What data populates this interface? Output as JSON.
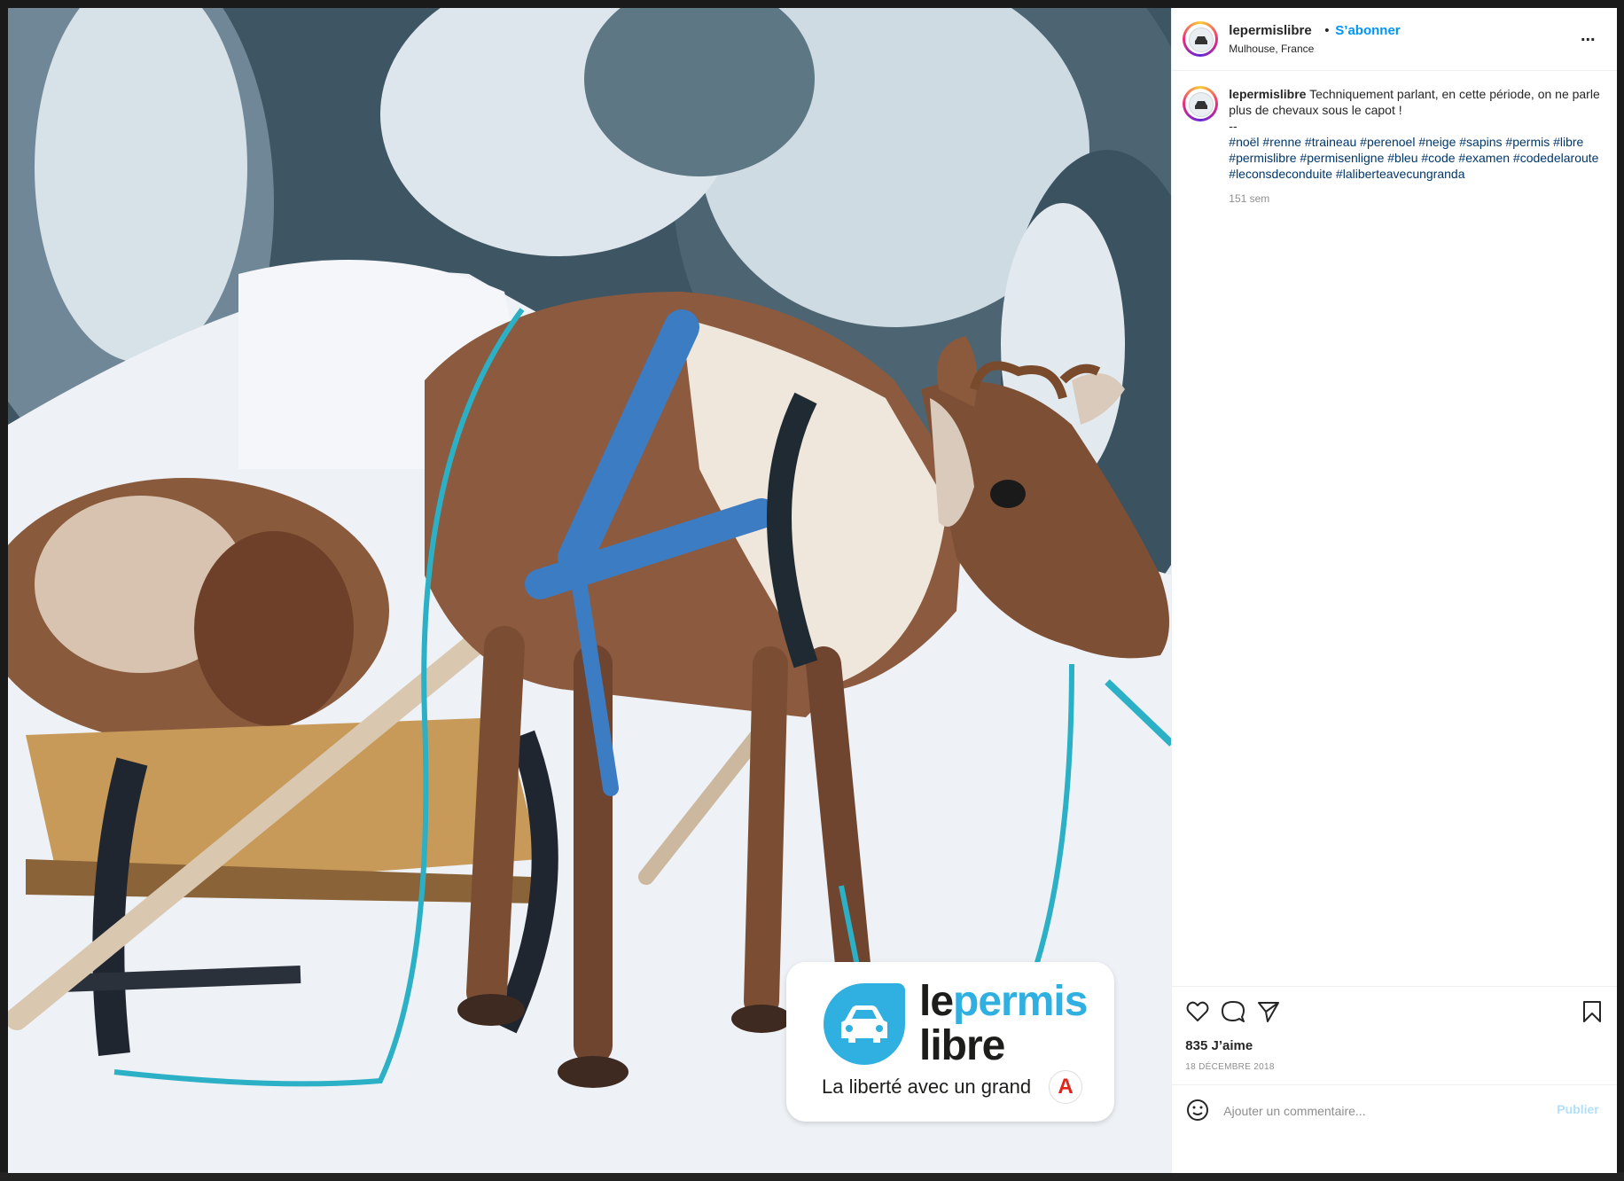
{
  "post": {
    "username": "lepermislibre",
    "separator": "•",
    "follow_label": "S’abonner",
    "location": "Mulhouse, France",
    "more_label": "..."
  },
  "caption": {
    "username": "lepermislibre",
    "text": "Techniquement parlant, en cette période, on ne parle plus de chevaux sous le capot !",
    "dashes": "--",
    "hashtags": "#noël #renne #traineau #perenoel #neige #sapins #permis #libre #permislibre #permisenligne #bleu #code #examen #codedelaroute #leconsdeconduite #laliberteavecungranda",
    "time": "151 sem"
  },
  "engagement": {
    "likes": "835 J’aime",
    "date": "18 DÉCEMBRE 2018"
  },
  "comment_box": {
    "placeholder": "Ajouter un commentaire...",
    "publish_label": "Publier"
  },
  "image_overlay": {
    "brand_name_part1": "le",
    "brand_name_part2": "permis",
    "brand_name_line2": "libre",
    "tagline": "La liberté avec un grand",
    "tag_letter": "A"
  },
  "colors": {
    "accent": "#0095f6",
    "hashtag": "#00376b",
    "brand_blue": "#2fb0e0",
    "brand_red": "#e2231a"
  },
  "icons": [
    "heart-icon",
    "comment-icon",
    "share-icon",
    "bookmark-icon",
    "emoji-icon",
    "more-icon"
  ]
}
